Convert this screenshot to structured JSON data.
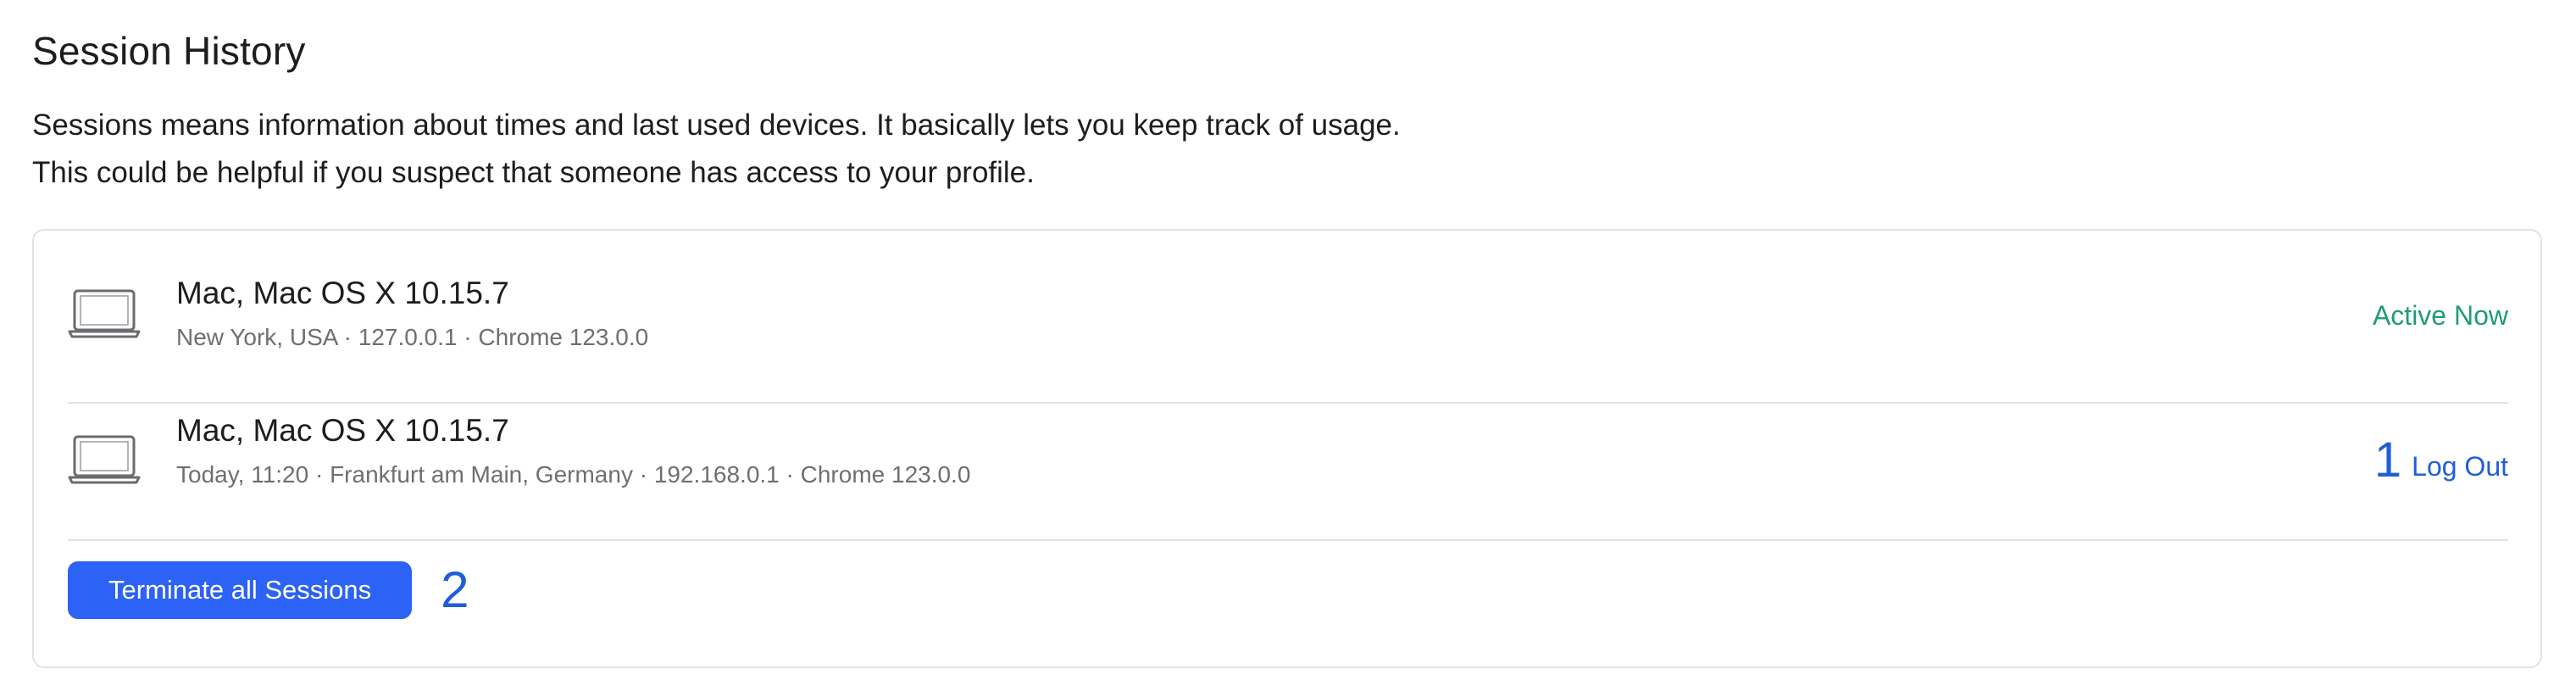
{
  "header": {
    "title": "Session History",
    "description_lines": [
      "Sessions means information about times and last used devices. It basically lets you keep track of usage.",
      "This could be helpful if you suspect that someone has access to your profile."
    ]
  },
  "sessions": [
    {
      "device": "Mac, Mac OS X 10.15.7",
      "details": "New York, USA · 127.0.0.1 · Chrome 123.0.0",
      "status": "Active Now",
      "icon": "laptop-icon"
    },
    {
      "device": "Mac, Mac OS X 10.15.7",
      "details": "Today, 11:20 · Frankfurt am Main, Germany · 192.168.0.1 · Chrome 123.0.0",
      "action": "Log Out",
      "marker": "1",
      "icon": "laptop-icon"
    }
  ],
  "footer": {
    "terminate_label": "Terminate all Sessions",
    "marker": "2"
  },
  "colors": {
    "accent": "#2c62f5",
    "active": "#1f9e6e",
    "link": "#1f5fd6",
    "muted_text": "#6e6e73",
    "border": "#e3e3e6"
  }
}
